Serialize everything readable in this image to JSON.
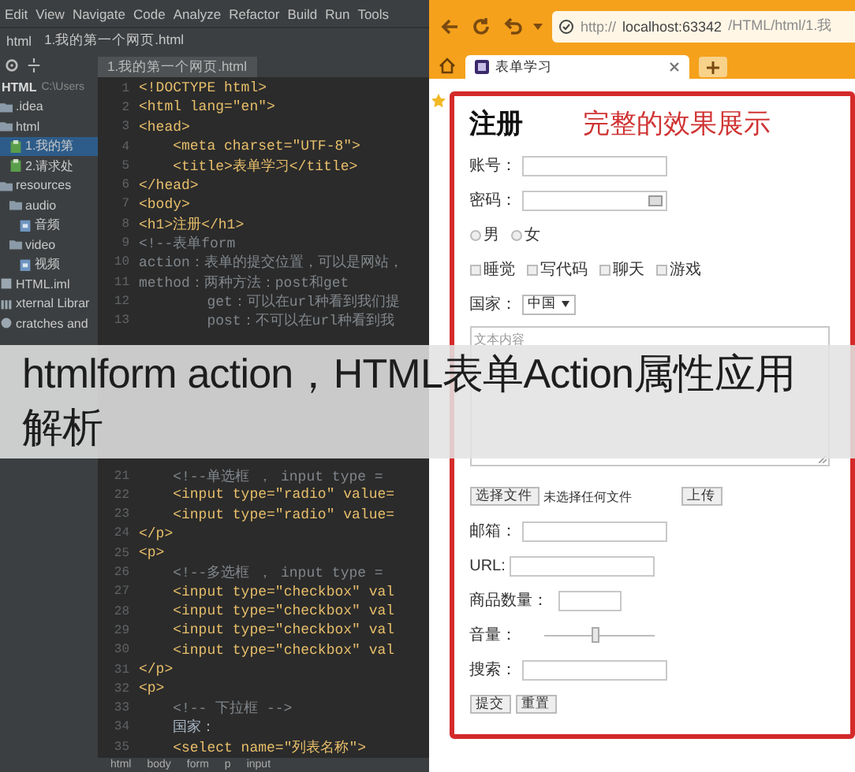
{
  "ide": {
    "menu": [
      "Edit",
      "View",
      "Navigate",
      "Code",
      "Analyze",
      "Refactor",
      "Build",
      "Run",
      "Tools"
    ],
    "breadcrumb": [
      "html",
      "1.我的第一个网页.html"
    ],
    "project_root": {
      "name": "HTML",
      "path": "C:\\Users"
    },
    "tree": [
      {
        "label": ".idea",
        "kind": "folder",
        "selected": false
      },
      {
        "label": "html",
        "kind": "folder",
        "selected": false,
        "children": [
          {
            "label": "1.我的第",
            "kind": "file",
            "selected": true
          },
          {
            "label": "2.请求处",
            "kind": "file",
            "selected": false
          }
        ]
      },
      {
        "label": "resources",
        "kind": "folder",
        "selected": false,
        "children": [
          {
            "label": "audio",
            "kind": "folder",
            "selected": false,
            "children": [
              {
                "label": "音频",
                "kind": "media",
                "selected": false
              }
            ]
          },
          {
            "label": "video",
            "kind": "folder",
            "selected": false,
            "children": [
              {
                "label": "视频",
                "kind": "media",
                "selected": false
              }
            ]
          }
        ]
      },
      {
        "label": "HTML.iml",
        "kind": "module",
        "selected": false
      },
      {
        "label": "xternal Librar",
        "kind": "library",
        "selected": false
      },
      {
        "label": "cratches and",
        "kind": "scratch",
        "selected": false
      }
    ],
    "editor_tab": "1.我的第一个网页.html",
    "code_top": [
      {
        "n": "1",
        "text": "<!DOCTYPE html>",
        "kind": "tag"
      },
      {
        "n": "2",
        "text": "<html lang=\"en\">",
        "kind": "tag"
      },
      {
        "n": "3",
        "text": "<head>",
        "kind": "tag"
      },
      {
        "n": "4",
        "text": "    <meta charset=\"UTF-8\">",
        "kind": "tag"
      },
      {
        "n": "5",
        "text": "    <title>表单学习</title>",
        "kind": "tag"
      },
      {
        "n": "6",
        "text": "</head>",
        "kind": "tag"
      },
      {
        "n": "7",
        "text": "<body>",
        "kind": "tag"
      },
      {
        "n": "8",
        "text": "<h1>注册</h1>",
        "kind": "tag"
      },
      {
        "n": "9",
        "text": "<!--表单form",
        "kind": "comment"
      },
      {
        "n": "10",
        "text": "action：表单的提交位置，可以是网站，",
        "kind": "comment"
      },
      {
        "n": "11",
        "text": "method：两种方法：post和get",
        "kind": "comment"
      },
      {
        "n": "12",
        "text": "        get：可以在url种看到我们提",
        "kind": "comment"
      },
      {
        "n": "13",
        "text": "        post：不可以在url种看到我",
        "kind": "comment"
      }
    ],
    "code_bottom": [
      {
        "n": "21",
        "text": "    <!--单选框 ， input type = ",
        "kind": "comment"
      },
      {
        "n": "22",
        "text": "    <input type=\"radio\" value=",
        "kind": "tag"
      },
      {
        "n": "23",
        "text": "    <input type=\"radio\" value=",
        "kind": "tag"
      },
      {
        "n": "24",
        "text": "</p>",
        "kind": "tag"
      },
      {
        "n": "25",
        "text": "<p>",
        "kind": "tag"
      },
      {
        "n": "26",
        "text": "    <!--多选框 ， input type = ",
        "kind": "comment"
      },
      {
        "n": "27",
        "text": "    <input type=\"checkbox\" val",
        "kind": "tag"
      },
      {
        "n": "28",
        "text": "    <input type=\"checkbox\" val",
        "kind": "tag"
      },
      {
        "n": "29",
        "text": "    <input type=\"checkbox\" val",
        "kind": "tag"
      },
      {
        "n": "30",
        "text": "    <input type=\"checkbox\" val",
        "kind": "tag"
      },
      {
        "n": "31",
        "text": "</p>",
        "kind": "tag"
      },
      {
        "n": "32",
        "text": "<p>",
        "kind": "tag"
      },
      {
        "n": "33",
        "text": "    <!-- 下拉框 -->",
        "kind": "comment"
      },
      {
        "n": "34",
        "text": "    国家：",
        "kind": "text"
      },
      {
        "n": "35",
        "text": "    <select name=\"列表名称\">",
        "kind": "tag"
      }
    ],
    "status_path": [
      "html",
      "body",
      "form",
      "p",
      "input"
    ]
  },
  "browser": {
    "url": "http://**localhost:63342**/HTML/html/1.我",
    "tabs": [
      {
        "title": "表单学习",
        "selected": true
      }
    ],
    "form": {
      "title": "注册",
      "annotation": "完整的效果展示",
      "rows": [
        {
          "kind": "text",
          "label": "账号："
        },
        {
          "kind": "password",
          "label": "密码："
        },
        {
          "kind": "radio",
          "options": [
            {
              "label": "男",
              "selected": false
            },
            {
              "label": "女",
              "selected": false
            }
          ]
        },
        {
          "kind": "checkbox",
          "options": [
            {
              "label": "睡觉",
              "checked": false
            },
            {
              "label": "写代码",
              "checked": false
            },
            {
              "label": "聊天",
              "checked": false
            },
            {
              "label": "游戏",
              "checked": false
            }
          ]
        },
        {
          "kind": "select",
          "label": "国家：",
          "value": "中国"
        },
        {
          "kind": "textarea",
          "placeholder": "文本内容"
        },
        {
          "kind": "file",
          "button": "选择文件",
          "status": "未选择任何文件",
          "upload": "上传"
        },
        {
          "kind": "text",
          "label": "邮箱："
        },
        {
          "kind": "text",
          "label": "URL:"
        },
        {
          "kind": "number",
          "label": "商品数量："
        },
        {
          "kind": "range",
          "label": "音量：",
          "level": 0.47
        },
        {
          "kind": "text",
          "label": "搜索："
        },
        {
          "kind": "buttons",
          "buttons": [
            "提交",
            "重置"
          ]
        }
      ]
    }
  },
  "banner": {
    "text": "htmlform action，HTML表单Action属性应用解析"
  }
}
